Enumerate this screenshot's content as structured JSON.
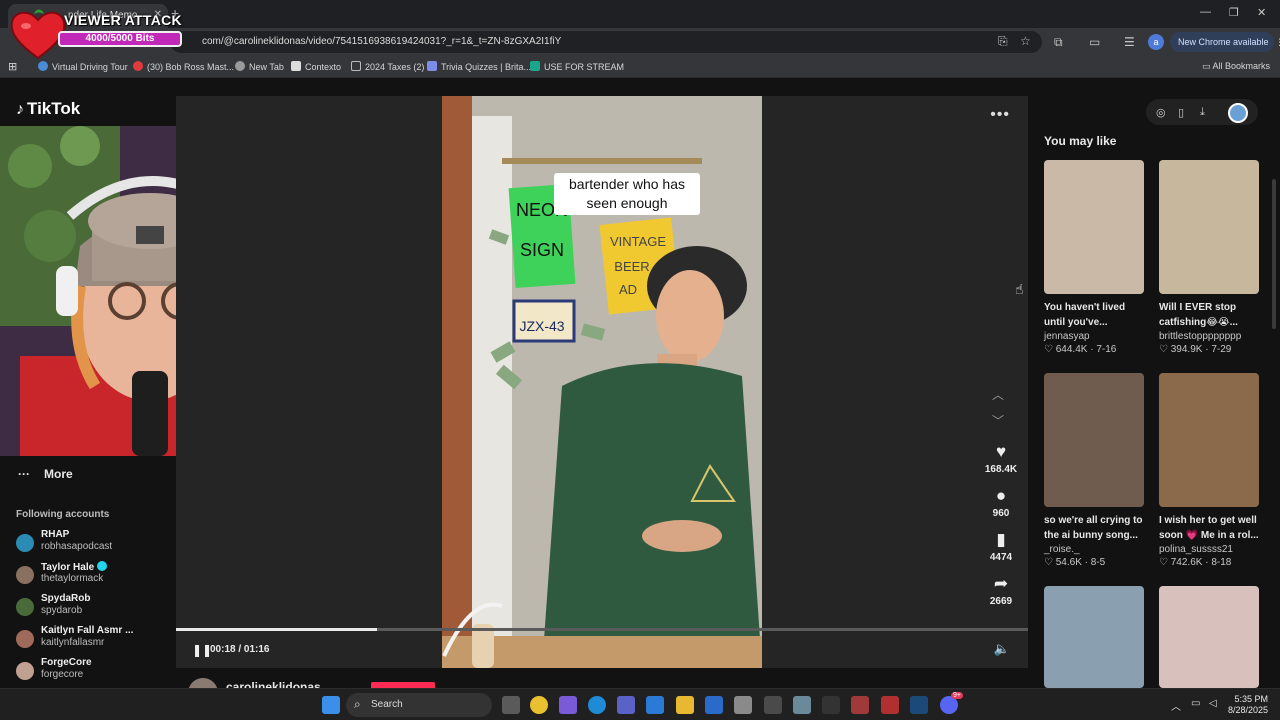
{
  "browser": {
    "tab_title": "nder Life Memo",
    "url": "com/@carolineklidonas/video/7541516938619424031?_r=1&_t=ZN-8zGXA2I1fiY",
    "new_chrome": "New Chrome available",
    "profile_initial": "a",
    "bookmarks": [
      {
        "label": "Virtual Driving Tour",
        "color": "#4a8bd6"
      },
      {
        "label": "(30) Bob Ross Mast...",
        "color": "#e23b3b"
      },
      {
        "label": "New Tab",
        "color": "#9a9a9a"
      },
      {
        "label": "Contexto",
        "color": "#dddddd"
      },
      {
        "label": "2024 Taxes (2)",
        "color": "#9a9a9a"
      },
      {
        "label": "Trivia Quizzes | Brita...",
        "color": "#7d8ce8"
      },
      {
        "label": "USE FOR STREAM",
        "color": "#1aa58c"
      }
    ],
    "all_bookmarks": "All Bookmarks"
  },
  "overlay": {
    "title": "VIEWER ATTACK",
    "bits": "4000/5000 Bits"
  },
  "tiktok": {
    "logo": "TikTok",
    "more": "More",
    "following_header": "Following accounts",
    "accounts": [
      {
        "name": "RHAP",
        "handle": "robhasapodcast",
        "color": "#2b8bb5"
      },
      {
        "name": "Taylor Hale",
        "handle": "thetaylormack",
        "color": "#8a7060",
        "verified": true
      },
      {
        "name": "SpydaRob",
        "handle": "spydarob",
        "color": "#4a6a3a"
      },
      {
        "name": "Kaitlyn Fall Asmr ...",
        "handle": "kaitlynfallasmr",
        "color": "#a06a5a"
      },
      {
        "name": "ForgeCore",
        "handle": "forgecore",
        "color": "#c0a090"
      }
    ],
    "video": {
      "caption_line1": "bartender who has",
      "caption_line2": "seen enough",
      "sign_neon": "NEON SIGN",
      "sign_beer": "VINTAGE BEER AD",
      "plate": "JZX-43",
      "time": "00:18 / 01:16",
      "progress": 0.236,
      "likes": "168.4K",
      "comments": "960",
      "saves": "4474",
      "shares": "2669"
    },
    "creator": "carolineklidonas",
    "you_may_like": "You may like",
    "cards": [
      {
        "caption": "You haven't lived until you've...",
        "author": "jennasyap",
        "stats": "♡ 644.4K · 7-16",
        "bg": "#c9b9a6"
      },
      {
        "caption": "Will I EVER stop catfishing😂😭...",
        "author": "brittlestopppppppp",
        "stats": "♡ 394.9K · 7-29",
        "bg": "#c7b79c"
      },
      {
        "caption": "so we're all crying to the ai bunny song...",
        "author": "_roise._",
        "stats": "♡ 54.6K · 8-5",
        "bg": "#6f5c4f"
      },
      {
        "caption": "I wish her to get well soon 💗 Me in a rol...",
        "author": "polina_sussss21",
        "stats": "♡ 742.6K · 8-18",
        "bg": "#8a6a4a"
      },
      {
        "caption": "",
        "author": "",
        "stats": "",
        "bg": "#8aa0b0"
      },
      {
        "caption": "",
        "author": "",
        "stats": "",
        "bg": "#d8c0bc"
      }
    ]
  },
  "taskbar": {
    "search": "Search",
    "time": "5:35 PM",
    "date": "8/28/2025",
    "badge": "9+"
  }
}
